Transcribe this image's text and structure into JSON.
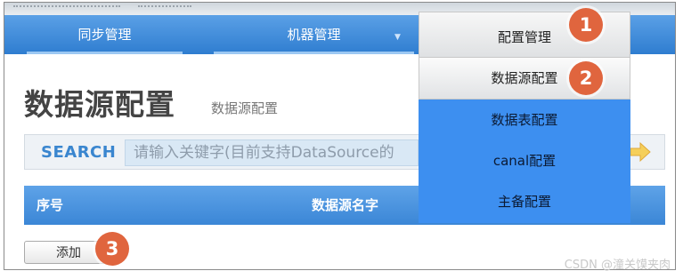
{
  "nav": {
    "items": [
      {
        "label": "同步管理"
      },
      {
        "label": "机器管理"
      }
    ]
  },
  "dropdown": {
    "head_label": "配置管理",
    "items": [
      {
        "label": "数据源配置"
      },
      {
        "label": "数据表配置"
      },
      {
        "label": "canal配置"
      },
      {
        "label": "主备配置"
      }
    ]
  },
  "page": {
    "title": "数据源配置",
    "subtitle": "数据源配置"
  },
  "search": {
    "label": "SEARCH",
    "placeholder": "请输入关键字(目前支持DataSource的"
  },
  "table": {
    "columns": [
      "序号",
      "数据源名字"
    ]
  },
  "actions": {
    "add_label": "添加"
  },
  "markers": [
    "1",
    "2",
    "3"
  ],
  "watermark": "CSDN @潼关馍夹肉",
  "colors": {
    "nav_blue": "#2f7dd0",
    "dropdown_blue": "#3d8ff0",
    "marker_orange": "#e0653e",
    "search_label": "#3a86cf"
  }
}
